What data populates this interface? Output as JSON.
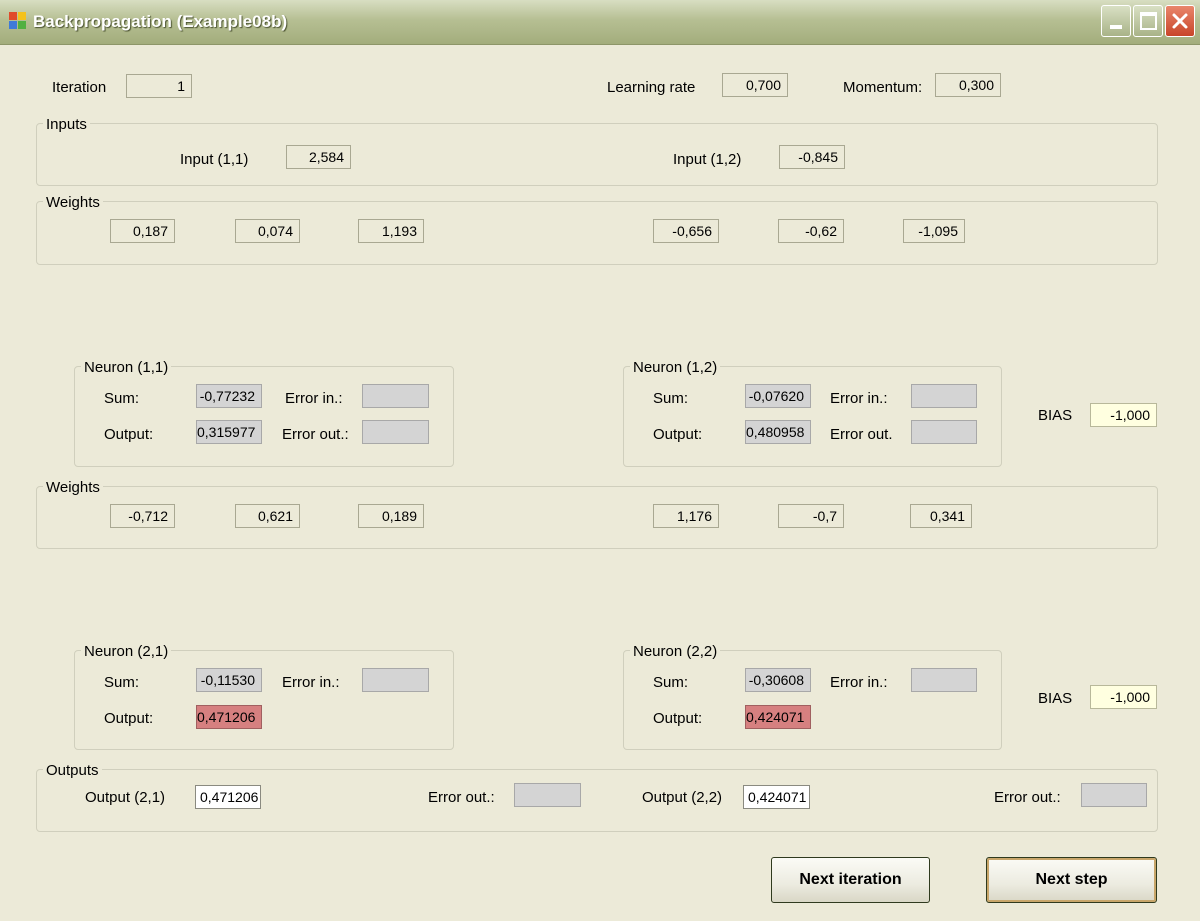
{
  "window": {
    "title": "Backpropagation (Example08b)"
  },
  "header": {
    "iteration_label": "Iteration",
    "iteration_value": "1",
    "learning_rate_label": "Learning rate",
    "learning_rate_value": "0,700",
    "momentum_label": "Momentum:",
    "momentum_value": "0,300"
  },
  "inputs": {
    "title": "Inputs",
    "input1_label": "Input (1,1)",
    "input1_value": "2,584",
    "input2_label": "Input (1,2)",
    "input2_value": "-0,845"
  },
  "weights1": {
    "title": "Weights",
    "values": [
      "0,187",
      "0,074",
      "1,193",
      "-0,656",
      "-0,62",
      "-1,095"
    ]
  },
  "neuron11": {
    "title": "Neuron (1,1)",
    "sum_label": "Sum:",
    "sum_value": "-0,77232",
    "output_label": "Output:",
    "output_value": "0,315977",
    "error_in_label": "Error in.:",
    "error_out_label": "Error out.:"
  },
  "neuron12": {
    "title": "Neuron (1,2)",
    "sum_label": "Sum:",
    "sum_value": "-0,07620",
    "output_label": "Output:",
    "output_value": "0,480958",
    "error_in_label": "Error in.:",
    "error_out_label": "Error out."
  },
  "bias1": {
    "label": "BIAS",
    "value": "-1,000"
  },
  "weights2": {
    "title": "Weights",
    "values": [
      "-0,712",
      "0,621",
      "0,189",
      "1,176",
      "-0,7",
      "0,341"
    ]
  },
  "neuron21": {
    "title": "Neuron (2,1)",
    "sum_label": "Sum:",
    "sum_value": "-0,11530",
    "output_label": "Output:",
    "output_value": "0,471206",
    "error_in_label": "Error in.:"
  },
  "neuron22": {
    "title": "Neuron (2,2)",
    "sum_label": "Sum:",
    "sum_value": "-0,30608",
    "output_label": "Output:",
    "output_value": "0,424071",
    "error_in_label": "Error in.:"
  },
  "bias2": {
    "label": "BIAS",
    "value": "-1,000"
  },
  "outputs": {
    "title": "Outputs",
    "output1_label": "Output (2,1)",
    "output1_value": "0,471206",
    "error_out1_label": "Error out.:",
    "output2_label": "Output (2,2)",
    "output2_value": "0,424071",
    "error_out2_label": "Error out.:"
  },
  "buttons": {
    "next_iteration": "Next iteration",
    "next_step": "Next step"
  },
  "colors": {
    "window_bg": "#ecead8",
    "output_highlight": "#d68080",
    "bias_bg": "#ffffe0"
  }
}
